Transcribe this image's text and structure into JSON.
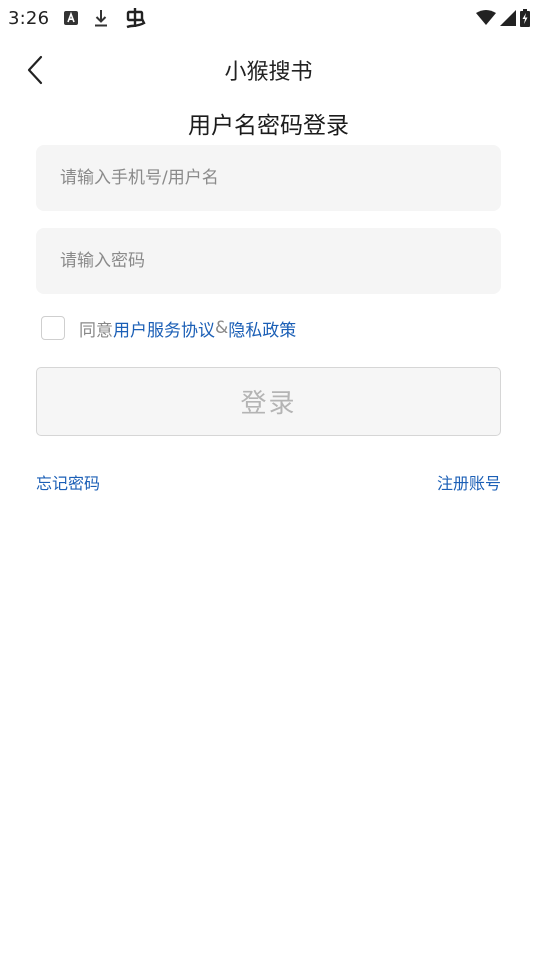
{
  "status_bar": {
    "time": "3:26",
    "icons": [
      "a-notification-icon",
      "download-icon",
      "bug-icon"
    ],
    "right_icons": [
      "wifi-icon",
      "signal-icon",
      "battery-charging-icon"
    ]
  },
  "header": {
    "title": "小猴搜书",
    "back_icon": "chevron-left-icon"
  },
  "login": {
    "heading": "用户名密码登录",
    "username_placeholder": "请输入手机号/用户名",
    "username_value": "",
    "password_placeholder": "请输入密码",
    "password_value": "",
    "agree_prefix": "同意",
    "agreement_link": "用户服务协议",
    "agree_joiner": "&",
    "privacy_link": "隐私政策",
    "agree_checked": false,
    "login_button": "登录",
    "forgot_password": "忘记密码",
    "register": "注册账号"
  },
  "colors": {
    "link": "#1b5fb6",
    "input_bg": "#f5f5f5",
    "button_disabled_text": "#b4b4b4"
  }
}
